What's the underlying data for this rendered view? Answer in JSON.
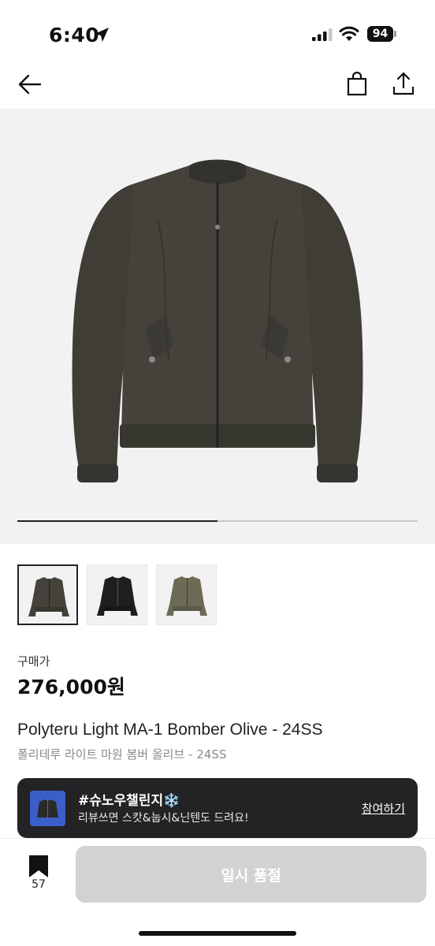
{
  "status_bar": {
    "time": "6:40",
    "battery": "94"
  },
  "product": {
    "price_label": "구매가",
    "price": "276,000원",
    "name_en": "Polyteru Light MA-1 Bomber Olive - 24SS",
    "name_ko": "폴리테루 라이트 마원 봄버 올리브 - 24SS",
    "image_progress": 0.5,
    "thumbnails": [
      {
        "color": "olive-dark",
        "selected": true
      },
      {
        "color": "black",
        "selected": false
      },
      {
        "color": "olive-light",
        "selected": false
      }
    ]
  },
  "banner": {
    "title": "#슈노우챌린지",
    "snow_icon": "❄️",
    "subtitle": "리뷰쓰면 스캇&눕시&닌텐도 드려요!",
    "link": "참여하기"
  },
  "bottom_bar": {
    "bookmark_count": "57",
    "action_label": "일시 품절"
  },
  "colors": {
    "banner_bg": "#232325",
    "button_disabled": "#d2d2d2",
    "hero_bg": "#f2f2f2"
  },
  "icons": {
    "back": "arrow-left-icon",
    "bag": "shopping-bag-icon",
    "share": "share-icon",
    "bookmark": "bookmark-icon"
  }
}
